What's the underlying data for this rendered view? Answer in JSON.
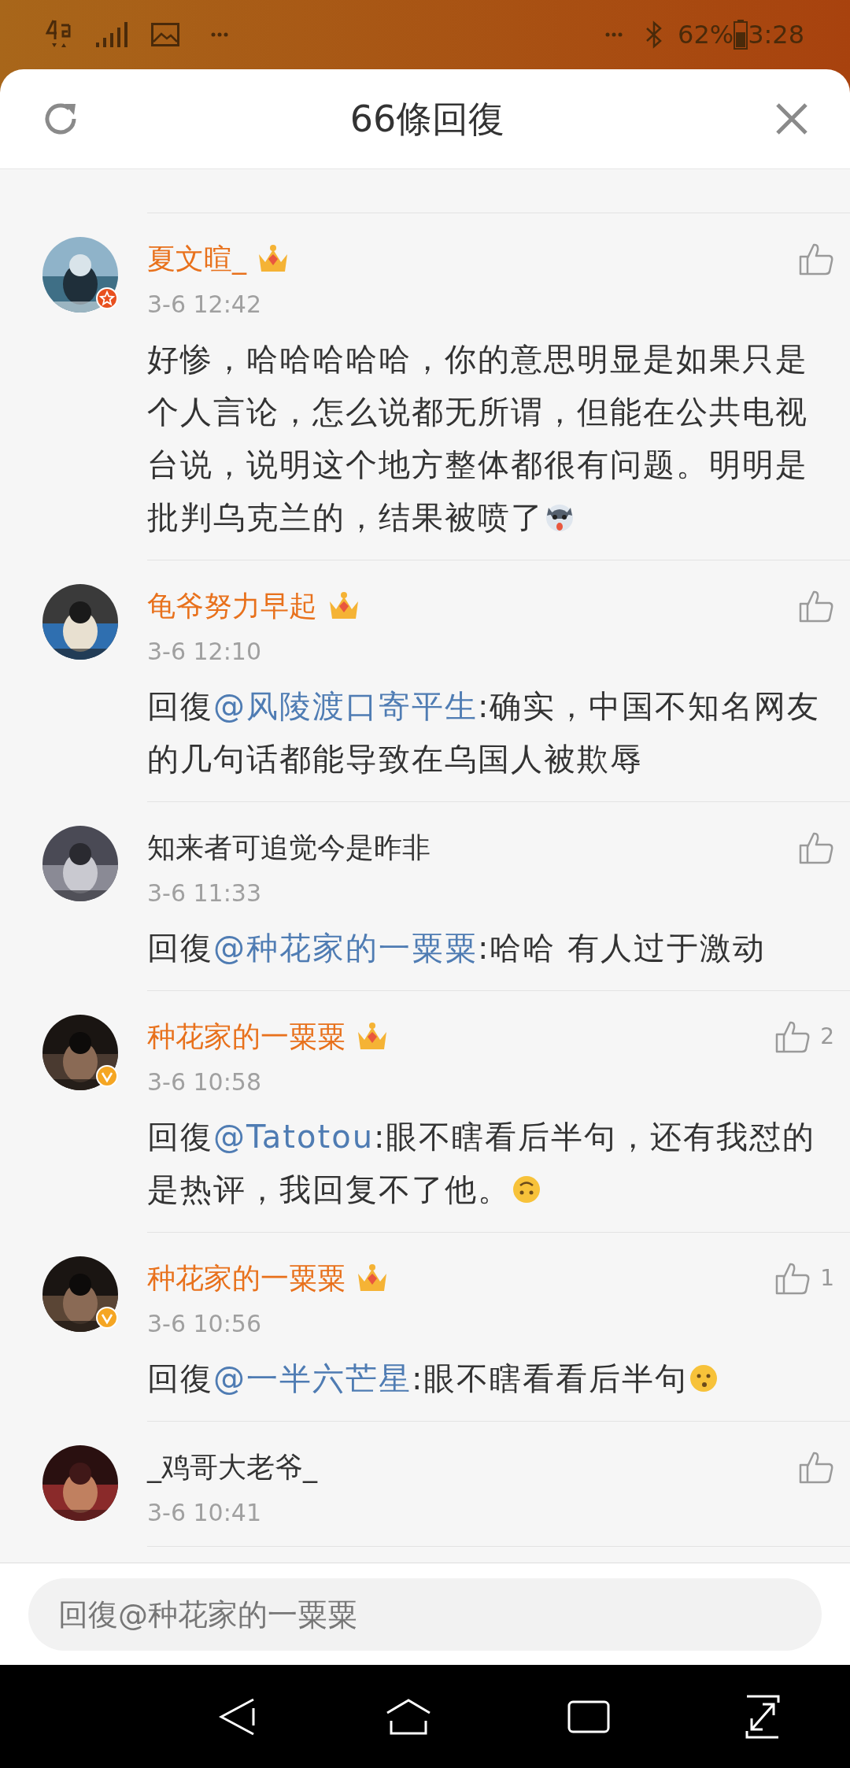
{
  "status_bar": {
    "battery_text": "62%",
    "time": "3:28"
  },
  "header": {
    "title": "66條回復"
  },
  "comments": [
    {
      "name": "夏文暄_",
      "crown": true,
      "avatar_badge": {
        "kind": "star"
      },
      "time": "3-6 12:42",
      "body": [
        {
          "kind": "text",
          "text": "好惨，哈哈哈哈哈，你的意思明显是如果只是个人言论，怎么说都无所谓，但能在公共电视台说，说明这个地方整体都很有问题。明明是批判乌克兰的，结果被喷了"
        }
      ],
      "emoji": {
        "kind": "dog"
      }
    },
    {
      "name": "龟爷努力早起",
      "crown": true,
      "time": "3-6 12:10",
      "body": [
        {
          "kind": "text",
          "text": "回復"
        },
        {
          "kind": "mention",
          "text": "@风陵渡口寄平生"
        },
        {
          "kind": "text",
          "text": ":确实，中国不知名网友的几句话都能导致在乌国人被欺辱"
        }
      ]
    },
    {
      "name": "知来者可追觉今是昨非",
      "crown": false,
      "time": "3-6 11:33",
      "body": [
        {
          "kind": "text",
          "text": "回復"
        },
        {
          "kind": "mention",
          "text": "@种花家的一粟粟"
        },
        {
          "kind": "text",
          "text": ":哈哈  有人过于激动"
        }
      ]
    },
    {
      "name": "种花家的一粟粟",
      "crown": true,
      "avatar_badge": {
        "kind": "verified"
      },
      "time": "3-6 10:58",
      "likes": "2",
      "body": [
        {
          "kind": "text",
          "text": "回復"
        },
        {
          "kind": "mention",
          "text": "@Tatotou"
        },
        {
          "kind": "text",
          "text": ":眼不瞎看后半句，还有我怼的是热评，我回复不了他。"
        }
      ],
      "emoji": {
        "kind": "upside-down"
      }
    },
    {
      "name": "种花家的一粟粟",
      "crown": true,
      "avatar_badge": {
        "kind": "verified"
      },
      "time": "3-6 10:56",
      "likes": "1",
      "body": [
        {
          "kind": "text",
          "text": "回復"
        },
        {
          "kind": "mention",
          "text": "@一半六芒星"
        },
        {
          "kind": "text",
          "text": ":眼不瞎看看后半句"
        }
      ],
      "emoji": {
        "kind": "thinking"
      }
    },
    {
      "name": "_鸡哥大老爷_",
      "crown": false,
      "time": "3-6 10:41"
    }
  ],
  "reply_field": {
    "placeholder": "回復@种花家的一粟粟"
  }
}
